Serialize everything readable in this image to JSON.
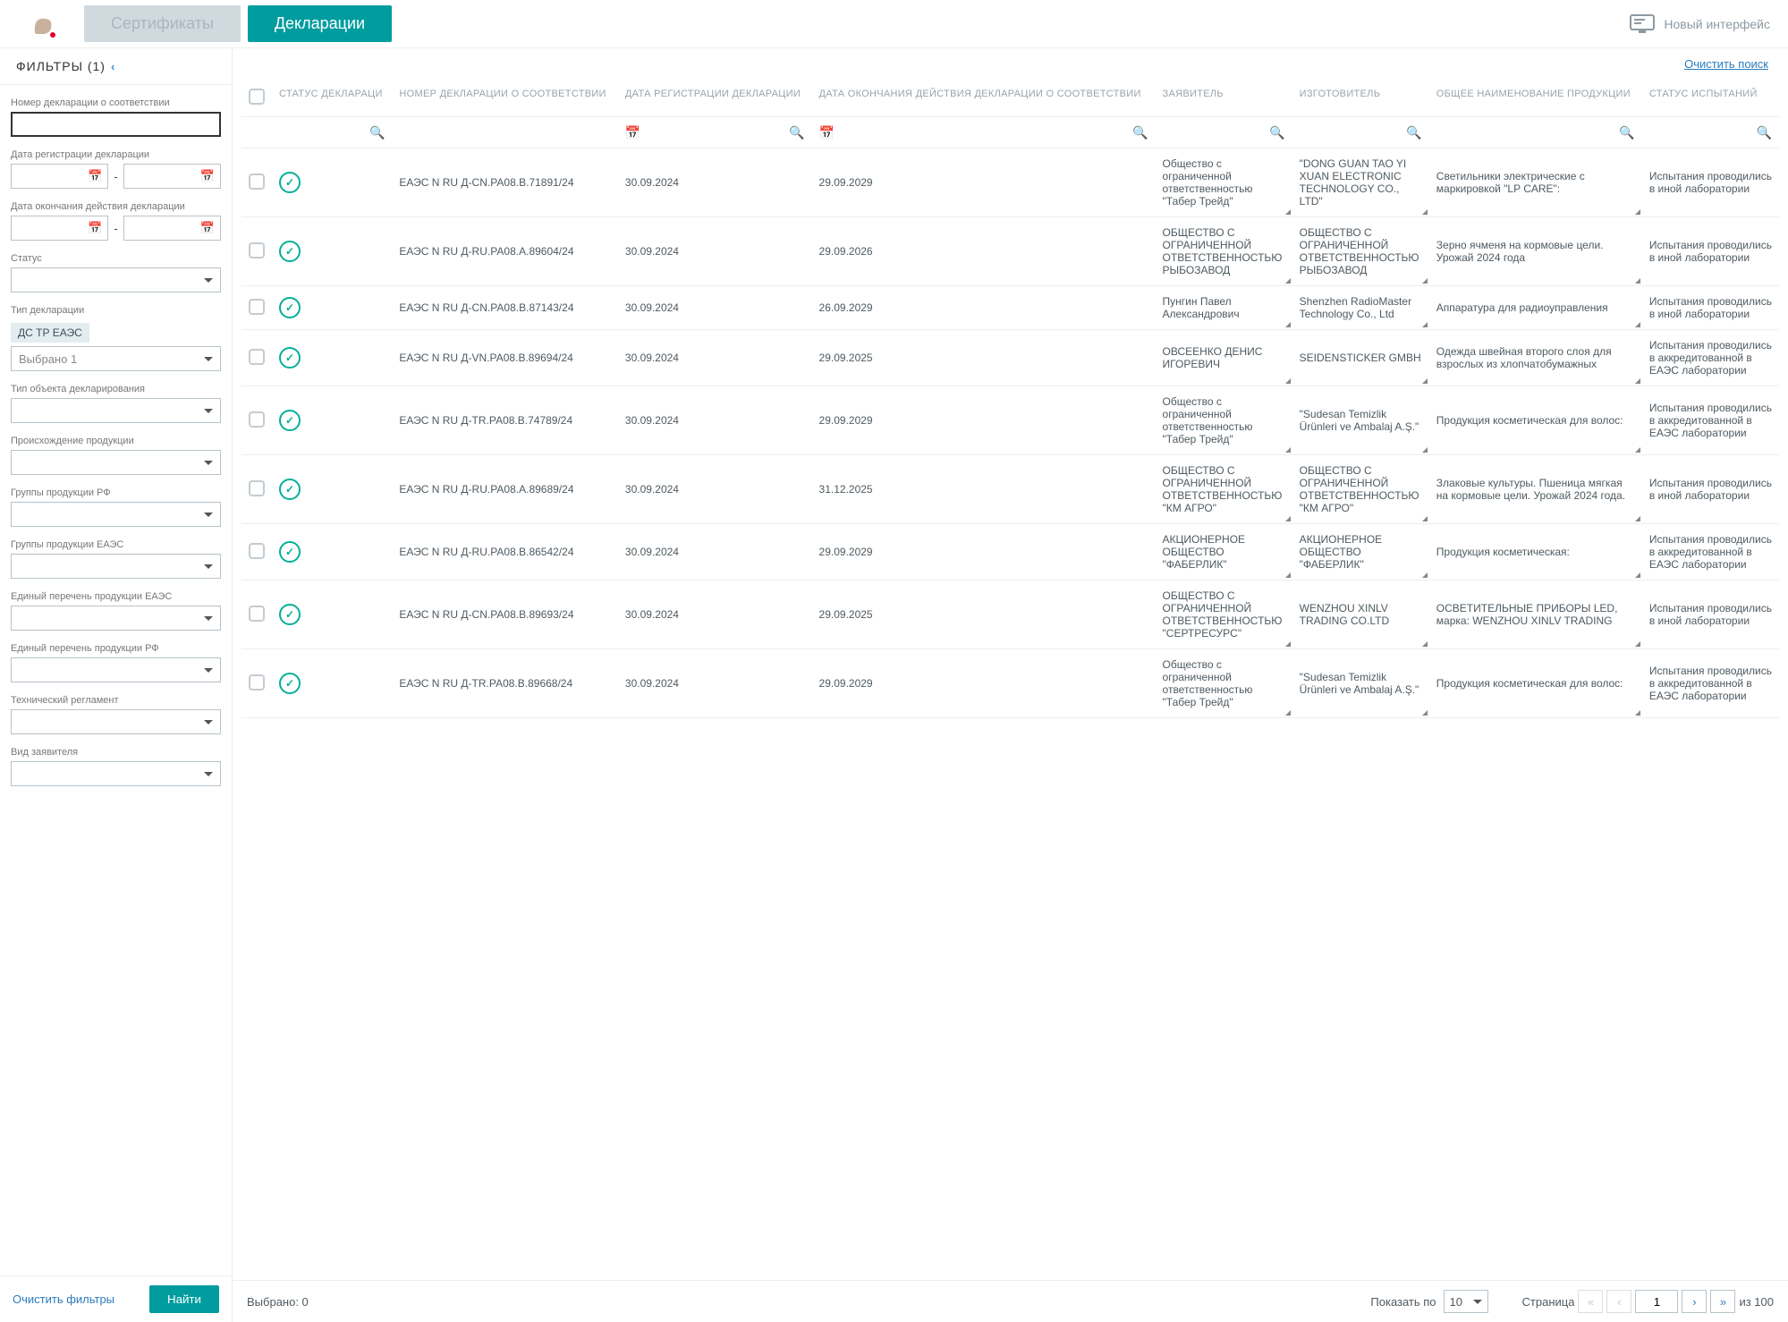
{
  "topbar": {
    "tabs": [
      {
        "label": "Сертификаты",
        "active": false
      },
      {
        "label": "Декларации",
        "active": true
      }
    ],
    "new_ui": "Новый интерфейс"
  },
  "sidebar": {
    "title": "ФИЛЬТРЫ (1)",
    "fields": {
      "decl_number_label": "Номер декларации о соответствии",
      "reg_date_label": "Дата регистрации декларации",
      "end_date_label": "Дата окончания действия декларации",
      "status_label": "Статус",
      "type_label": "Тип декларации",
      "type_tag": "ДС ТР ЕАЭС",
      "type_selected": "Выбрано 1",
      "obj_type_label": "Тип объекта декларирования",
      "origin_label": "Происхождение продукции",
      "groups_rf_label": "Группы продукции РФ",
      "groups_eaes_label": "Группы продукции ЕАЭС",
      "list_eaes_label": "Единый перечень продукции ЕАЭС",
      "list_rf_label": "Единый перечень продукции РФ",
      "tech_reg_label": "Технический регламент",
      "applicant_type_label": "Вид заявителя"
    },
    "separator": "-",
    "clear_filters": "Очистить фильтры",
    "find": "Найти"
  },
  "content": {
    "clear_search": "Очистить поиск",
    "columns": {
      "status": "СТАТУС ДЕКЛАРАЦИ",
      "number": "НОМЕР ДЕКЛАРАЦИИ О СООТВЕТСТВИИ",
      "reg_date": "ДАТА РЕГИСТРАЦИИ ДЕКЛАРАЦИИ",
      "end_date": "ДАТА ОКОНЧАНИЯ ДЕЙСТВИЯ ДЕКЛАРАЦИИ О СООТВЕТСТВИИ",
      "applicant": "ЗАЯВИТЕЛЬ",
      "manufacturer": "ИЗГОТОВИТЕЛЬ",
      "product": "ОБЩЕЕ НАИМЕНОВАНИЕ ПРОДУКЦИИ",
      "test_status": "СТАТУС ИСПЫТАНИЙ"
    },
    "rows": [
      {
        "number": "ЕАЭС N RU Д-CN.РА08.В.71891/24",
        "reg": "30.09.2024",
        "end": "29.09.2029",
        "applicant": "Общество с ограниченной ответственностью \"Табер Трейд\"",
        "manufacturer": "\"DONG GUAN TAO YI XUAN ELECTRONIC TECHNOLOGY CO., LTD\"",
        "product": "Светильники электрические с маркировкой \"LP CARE\":",
        "test": "Испытания проводились в иной лаборатории"
      },
      {
        "number": "ЕАЭС N RU Д-RU.РА08.А.89604/24",
        "reg": "30.09.2024",
        "end": "29.09.2026",
        "applicant": "ОБЩЕСТВО С ОГРАНИЧЕННОЙ ОТВЕТСТВЕННОСТЬЮ РЫБОЗАВОД",
        "manufacturer": "ОБЩЕСТВО С ОГРАНИЧЕННОЙ ОТВЕТСТВЕННОСТЬЮ РЫБОЗАВОД",
        "product": "Зерно ячменя на кормовые цели. Урожай 2024 года",
        "test": "Испытания проводились в иной лаборатории"
      },
      {
        "number": "ЕАЭС N RU Д-CN.РА08.В.87143/24",
        "reg": "30.09.2024",
        "end": "26.09.2029",
        "applicant": "Пунгин Павел Александрович",
        "manufacturer": "Shenzhen RadioMaster Technology Co., Ltd",
        "product": "Аппаратура для радиоуправления",
        "test": "Испытания проводились в иной лаборатории"
      },
      {
        "number": "ЕАЭС N RU Д-VN.РА08.В.89694/24",
        "reg": "30.09.2024",
        "end": "29.09.2025",
        "applicant": "ОВСЕЕНКО ДЕНИС ИГОРЕВИЧ",
        "manufacturer": "SEIDENSTICKER GMBH",
        "product": "Одежда швейная второго слоя для взрослых из хлопчатобумажных",
        "test": "Испытания проводились в аккредитованной в ЕАЭС лаборатории"
      },
      {
        "number": "ЕАЭС N RU Д-TR.РА08.В.74789/24",
        "reg": "30.09.2024",
        "end": "29.09.2029",
        "applicant": "Общество с ограниченной ответственностью \"Табер Трейд\"",
        "manufacturer": "\"Sudesan Temizlik Ürünleri ve Ambalaj A.Ş.\"",
        "product": "Продукция косметическая для волос:",
        "test": "Испытания проводились в аккредитованной в ЕАЭС лаборатории"
      },
      {
        "number": "ЕАЭС N RU Д-RU.РА08.А.89689/24",
        "reg": "30.09.2024",
        "end": "31.12.2025",
        "applicant": "ОБЩЕСТВО С ОГРАНИЧЕННОЙ ОТВЕТСТВЕННОСТЬЮ \"КМ АГРО\"",
        "manufacturer": "ОБЩЕСТВО С ОГРАНИЧЕННОЙ ОТВЕТСТВЕННОСТЬЮ \"КМ АГРО\"",
        "product": "Злаковые культуры. Пшеница мягкая на кормовые цели. Урожай 2024 года.",
        "test": "Испытания проводились в иной лаборатории"
      },
      {
        "number": "ЕАЭС N RU Д-RU.РА08.В.86542/24",
        "reg": "30.09.2024",
        "end": "29.09.2029",
        "applicant": "АКЦИОНЕРНОЕ ОБЩЕСТВО \"ФАБЕРЛИК\"",
        "manufacturer": "АКЦИОНЕРНОЕ ОБЩЕСТВО \"ФАБЕРЛИК\"",
        "product": "Продукция косметическая:",
        "test": "Испытания проводились в аккредитованной в ЕАЭС лаборатории"
      },
      {
        "number": "ЕАЭС N RU Д-CN.РА08.В.89693/24",
        "reg": "30.09.2024",
        "end": "29.09.2025",
        "applicant": "ОБЩЕСТВО С ОГРАНИЧЕННОЙ ОТВЕТСТВЕННОСТЬЮ \"СЕРТРЕСУРC\"",
        "manufacturer": "WENZHOU XINLV TRADING CO.LTD",
        "product": "ОСВЕТИТЕЛЬНЫЕ ПРИБОРЫ LED, марка: WENZHOU XINLV TRADING",
        "test": "Испытания проводились в иной лаборатории"
      },
      {
        "number": "ЕАЭС N RU Д-TR.РА08.В.89668/24",
        "reg": "30.09.2024",
        "end": "29.09.2029",
        "applicant": "Общество с ограниченной ответственностью \"Табер Трейд\"",
        "manufacturer": "\"Sudesan Temizlik Ürünleri ve Ambalaj A.Ş.\"",
        "product": "Продукция косметическая для волос:",
        "test": "Испытания проводились в аккредитованной в ЕАЭС лаборатории"
      }
    ]
  },
  "footer": {
    "selected": "Выбрано: 0",
    "show_label": "Показать по",
    "page_size": "10",
    "page_label": "Страница",
    "page_current": "1",
    "of_label": "из 100"
  }
}
